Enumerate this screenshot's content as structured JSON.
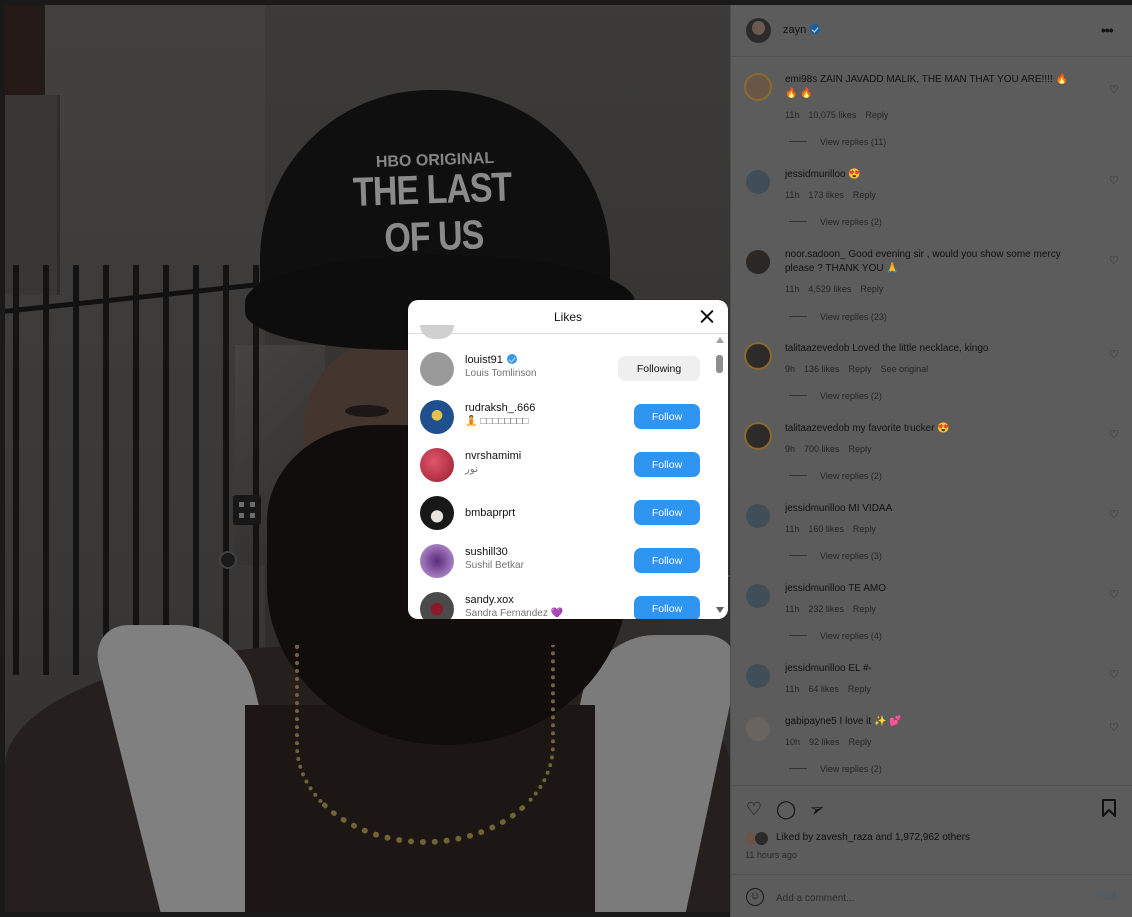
{
  "post": {
    "author": "zayn",
    "hat_line1": "HBO ORIGINAL",
    "hat_line2": "THE LAST OF US"
  },
  "comments": [
    {
      "user": "emi98s",
      "text": "ZAIN JAVADD MALIK, THE MAN THAT YOU ARE!!!! 🔥",
      "text2": "🔥 🔥",
      "time": "11h",
      "likes": "10,075 likes",
      "reply": "Reply",
      "replies": "View replies (11)"
    },
    {
      "user": "jessidmurilloo",
      "text": "😍",
      "time": "11h",
      "likes": "173 likes",
      "reply": "Reply",
      "replies": "View replies (2)"
    },
    {
      "user": "noor.sadoon_",
      "text": "Good evening sir , would you show some mercy",
      "text2": "please ? THANK YOU 🙏",
      "time": "11h",
      "likes": "4,529 likes",
      "reply": "Reply",
      "replies": "View replies (23)"
    },
    {
      "user": "talitaazevedob",
      "text": "Loved the little necklace, kingo",
      "time": "9h",
      "likes": "136 likes",
      "reply": "Reply",
      "extra": "See original",
      "replies": "View replies (2)"
    },
    {
      "user": "talitaazevedob",
      "text": "my favorite trucker 😍",
      "time": "9h",
      "likes": "700 likes",
      "reply": "Reply",
      "replies": "View replies (2)"
    },
    {
      "user": "jessidmurilloo",
      "text": "MI VIDAA",
      "time": "11h",
      "likes": "160 likes",
      "reply": "Reply",
      "replies": "View replies (3)"
    },
    {
      "user": "jessidmurilloo",
      "text": "TE AMO",
      "time": "11h",
      "likes": "232 likes",
      "reply": "Reply",
      "replies": "View replies (4)"
    },
    {
      "user": "jessidmurilloo",
      "text": "EL #-",
      "time": "11h",
      "likes": "64 likes",
      "reply": "Reply"
    },
    {
      "user": "gabipayne5",
      "text": "I love it ✨ 💕",
      "time": "10h",
      "likes": "92 likes",
      "reply": "Reply",
      "replies": "View replies (2)"
    }
  ],
  "actions": {
    "liked_prefix": "Liked by",
    "liked_user": "zavesh_raza",
    "liked_and": "and",
    "liked_count": "1,972,962 others",
    "time_ago": "11 hours ago",
    "comment_placeholder": "Add a comment...",
    "post_label": "Post"
  },
  "likes_modal": {
    "title": "Likes",
    "users": [
      {
        "username": "louist91",
        "name": "Louis Tomlinson",
        "verified": true,
        "button": "Following"
      },
      {
        "username": "rudraksh_.666",
        "name": "🧘 □□□□□□□□",
        "button": "Follow"
      },
      {
        "username": "nvrshamimi",
        "name": "نور",
        "button": "Follow"
      },
      {
        "username": "bmbaprprt",
        "name": "",
        "button": "Follow"
      },
      {
        "username": "sushill30",
        "name": "Sushil Betkar",
        "button": "Follow"
      },
      {
        "username": "sandy.xox",
        "name": "Sandra Fernandez 💜",
        "button": "Follow"
      }
    ]
  },
  "icons": {
    "more": "more-options-icon",
    "heart": "heart-icon",
    "comment": "comment-icon",
    "share": "share-icon",
    "save": "bookmark-icon",
    "emoji": "emoji-icon",
    "close": "close-icon"
  },
  "colors": {
    "follow_button": "#2e95f0",
    "following_button": "#efefef",
    "overlay_panel": "#5c5c5c"
  }
}
